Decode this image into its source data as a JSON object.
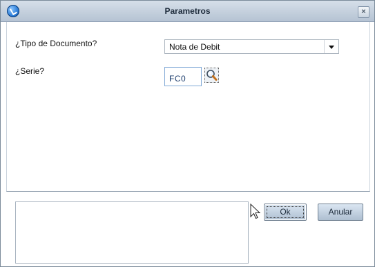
{
  "window": {
    "title": "Parametros",
    "close_glyph": "×"
  },
  "icons": {
    "app": "app-logo-icon",
    "close": "close-icon",
    "dropdown": "chevron-down-icon",
    "lookup": "magnifier-search-icon",
    "cursor": "mouse-pointer-icon"
  },
  "form": {
    "tipo_label": "¿Tipo de Documento?",
    "tipo_value": "Nota de Debit",
    "serie_label": "¿Serie?",
    "serie_value": "FC0"
  },
  "buttons": {
    "ok": "Ok",
    "cancel": "Anular"
  },
  "memo": {
    "value": ""
  },
  "colors": {
    "titlebar": "#c5d1de",
    "button": "#c4d2e2",
    "input_border": "#7fa8d6"
  }
}
